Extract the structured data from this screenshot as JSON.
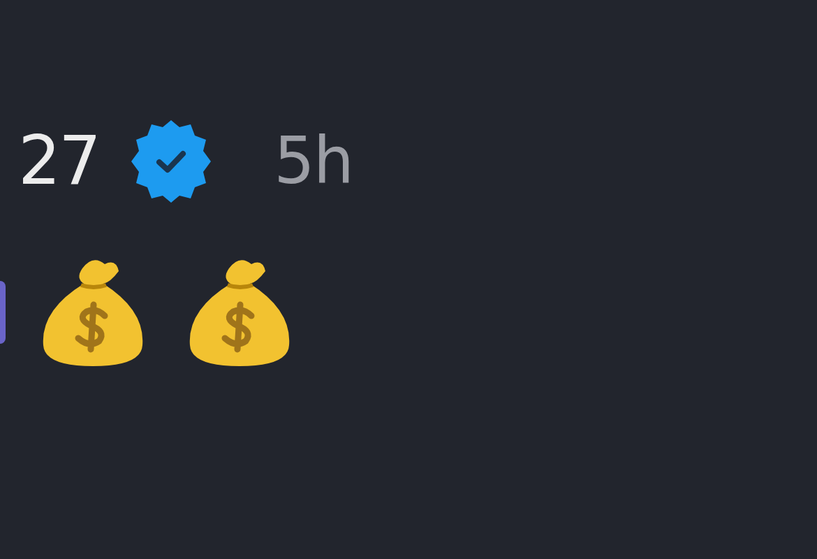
{
  "post": {
    "author": "27",
    "verified": true,
    "time": "5h"
  }
}
